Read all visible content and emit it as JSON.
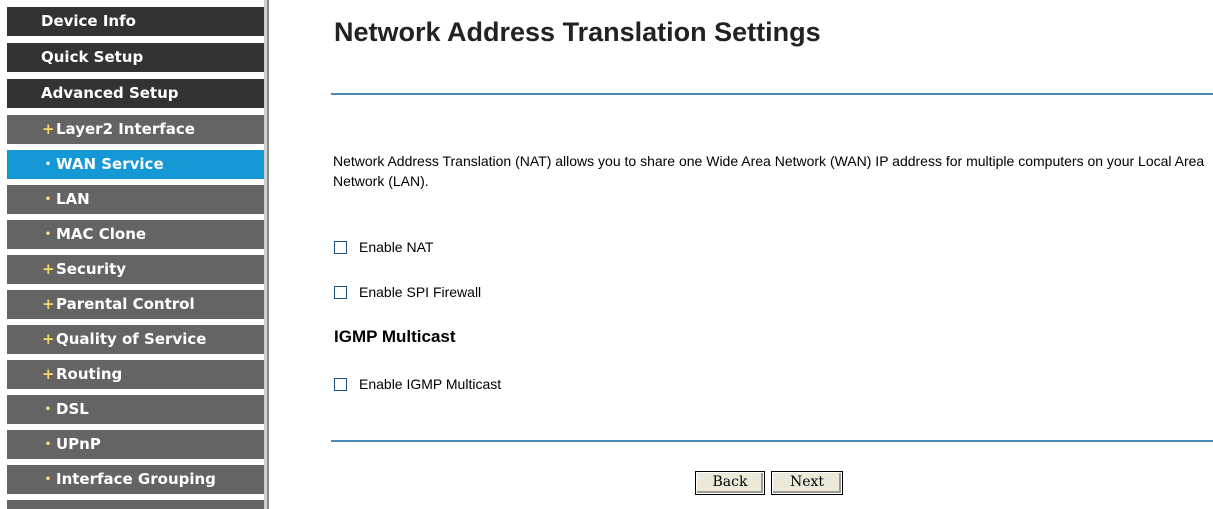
{
  "sidebar": {
    "items": [
      {
        "label": "Device Info",
        "level": "top",
        "bullet": ""
      },
      {
        "label": "Quick Setup",
        "level": "top",
        "bullet": ""
      },
      {
        "label": "Advanced Setup",
        "level": "top",
        "bullet": ""
      },
      {
        "label": "Layer2 Interface",
        "level": "sub",
        "bullet": "+"
      },
      {
        "label": "WAN Service",
        "level": "sub",
        "bullet": "•",
        "active": true
      },
      {
        "label": "LAN",
        "level": "sub",
        "bullet": "•"
      },
      {
        "label": "MAC Clone",
        "level": "sub",
        "bullet": "•"
      },
      {
        "label": "Security",
        "level": "sub",
        "bullet": "+"
      },
      {
        "label": "Parental Control",
        "level": "sub",
        "bullet": "+"
      },
      {
        "label": "Quality of Service",
        "level": "sub",
        "bullet": "+"
      },
      {
        "label": "Routing",
        "level": "sub",
        "bullet": "+"
      },
      {
        "label": "DSL",
        "level": "sub",
        "bullet": "•"
      },
      {
        "label": "UPnP",
        "level": "sub",
        "bullet": "•"
      },
      {
        "label": "Interface Grouping",
        "level": "sub",
        "bullet": "•"
      }
    ]
  },
  "main": {
    "title": "Network Address Translation Settings",
    "description": "Network Address Translation (NAT) allows you to share one Wide Area Network (WAN) IP address for multiple computers on your Local Area Network (LAN).",
    "options": {
      "enable_nat": {
        "label": "Enable NAT",
        "checked": false
      },
      "enable_spi_firewall": {
        "label": "Enable SPI Firewall",
        "checked": false
      }
    },
    "igmp": {
      "heading": "IGMP Multicast",
      "enable_igmp_multicast": {
        "label": "Enable IGMP Multicast",
        "checked": false
      }
    },
    "buttons": {
      "back": "Back",
      "next": "Next"
    }
  },
  "colors": {
    "nav_top_bg": "#333333",
    "nav_sub_bg": "#646464",
    "nav_active_bg": "#1598d6",
    "rule": "#4a8ab4"
  }
}
